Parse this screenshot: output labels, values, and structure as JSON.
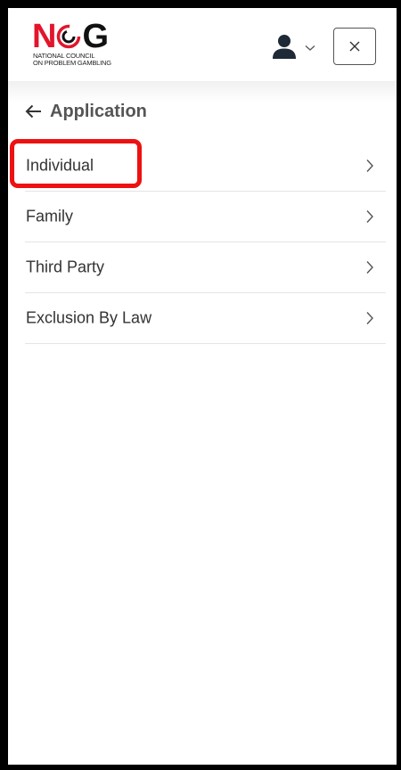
{
  "logo": {
    "letters": {
      "n": "N",
      "c": "C",
      "g": "G"
    },
    "subtitle_line1": "NATIONAL COUNCIL",
    "subtitle_line2": "ON PROBLEM GAMBLING",
    "brand_red": "#e2152c"
  },
  "header": {
    "user_icon": "user-icon",
    "user_chevron_icon": "chevron-down-icon",
    "close_icon": "close-icon"
  },
  "nav": {
    "back_icon": "arrow-left-icon",
    "title": "Application"
  },
  "menu": {
    "items": [
      {
        "label": "Individual",
        "icon": "chevron-right-icon"
      },
      {
        "label": "Family",
        "icon": "chevron-right-icon"
      },
      {
        "label": "Third Party",
        "icon": "chevron-right-icon"
      },
      {
        "label": "Exclusion By Law",
        "icon": "chevron-right-icon"
      }
    ]
  },
  "annotation": {
    "highlight_color": "#ee1111",
    "highlighted_item": "Individual"
  }
}
